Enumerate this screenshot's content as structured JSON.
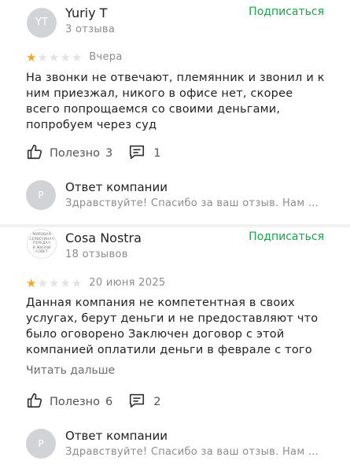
{
  "reviews": [
    {
      "author": {
        "initials": "YT",
        "name": "Yuriy T",
        "reviews_count": "3 отзыва"
      },
      "subscribe_label": "Подписаться",
      "rating": 1,
      "rating_max": 5,
      "date": "Вчера",
      "text": "На звонки не отвечают, племянник и звонил и к ним приезжал, никого в офисе нет, скорее всего попрощаемся со своими деньгами, попробуем через суд",
      "useful_label": "Полезно",
      "useful_count": "3",
      "comments_count": "1",
      "reply": {
        "avatar_letter": "Р",
        "title": "Ответ компании",
        "text": "Здравствуйте! Спасибо за ваш отзыв. Нам и…"
      }
    },
    {
      "author": {
        "logo_lines": [
          "МИРОВАЯ",
          "СЕРВЕЧИНАЧ",
          "ПЕРЕДАЧ",
          "В ЖИЗНИ",
          "СОВЕТ"
        ],
        "name": "Cosa Nostra",
        "reviews_count": "18 отзывов"
      },
      "subscribe_label": "Подписаться",
      "rating": 1,
      "rating_max": 5,
      "date": "20 июня 2025",
      "text": "Данная компания не компетентная в своих услугах, берут деньги и не предоставляют что было оговорено Заключен договор с этой компанией оплатили деньги в феврале с того …",
      "read_more": "Читать дальше",
      "useful_label": "Полезно",
      "useful_count": "6",
      "comments_count": "2",
      "reply": {
        "avatar_letter": "Р",
        "title": "Ответ компании",
        "text": "Здравствуйте! Спасибо за ваш отзыв. Нам и…"
      }
    }
  ],
  "colors": {
    "accent": "#1aa34a",
    "star_on": "#f5a623",
    "star_off": "#e3e3e3",
    "muted": "#8c8c8c"
  },
  "icons": {
    "like": "thumbs-up-icon",
    "comment": "comment-icon",
    "star": "star-icon"
  }
}
